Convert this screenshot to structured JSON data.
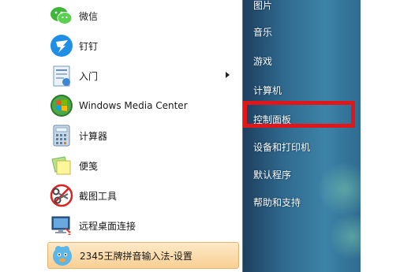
{
  "programs": [
    {
      "label": "微信",
      "icon": "wechat-icon"
    },
    {
      "label": "钉钉",
      "icon": "dingtalk-icon"
    },
    {
      "label": "入门",
      "icon": "getting-started-icon"
    },
    {
      "label": "Windows Media Center",
      "icon": "windows-media-center-icon"
    },
    {
      "label": "计算器",
      "icon": "calculator-icon"
    },
    {
      "label": "便笺",
      "icon": "sticky-notes-icon"
    },
    {
      "label": "截图工具",
      "icon": "snipping-tool-icon"
    },
    {
      "label": "远程桌面连接",
      "icon": "remote-desktop-icon"
    },
    {
      "label": "2345王牌拼音输入法-设置",
      "icon": "input-method-icon"
    }
  ],
  "right_menu": [
    {
      "label": "图片"
    },
    {
      "label": "音乐"
    },
    {
      "label": "游戏"
    },
    {
      "label": "计算机"
    },
    {
      "label": "控制面板"
    },
    {
      "label": "设备和打印机"
    },
    {
      "label": "默认程序"
    },
    {
      "label": "帮助和支持"
    }
  ],
  "colors": {
    "highlight_box": "#e0161a",
    "right_pane": "#2f6a8e",
    "selected_item": "#f9cf93"
  }
}
